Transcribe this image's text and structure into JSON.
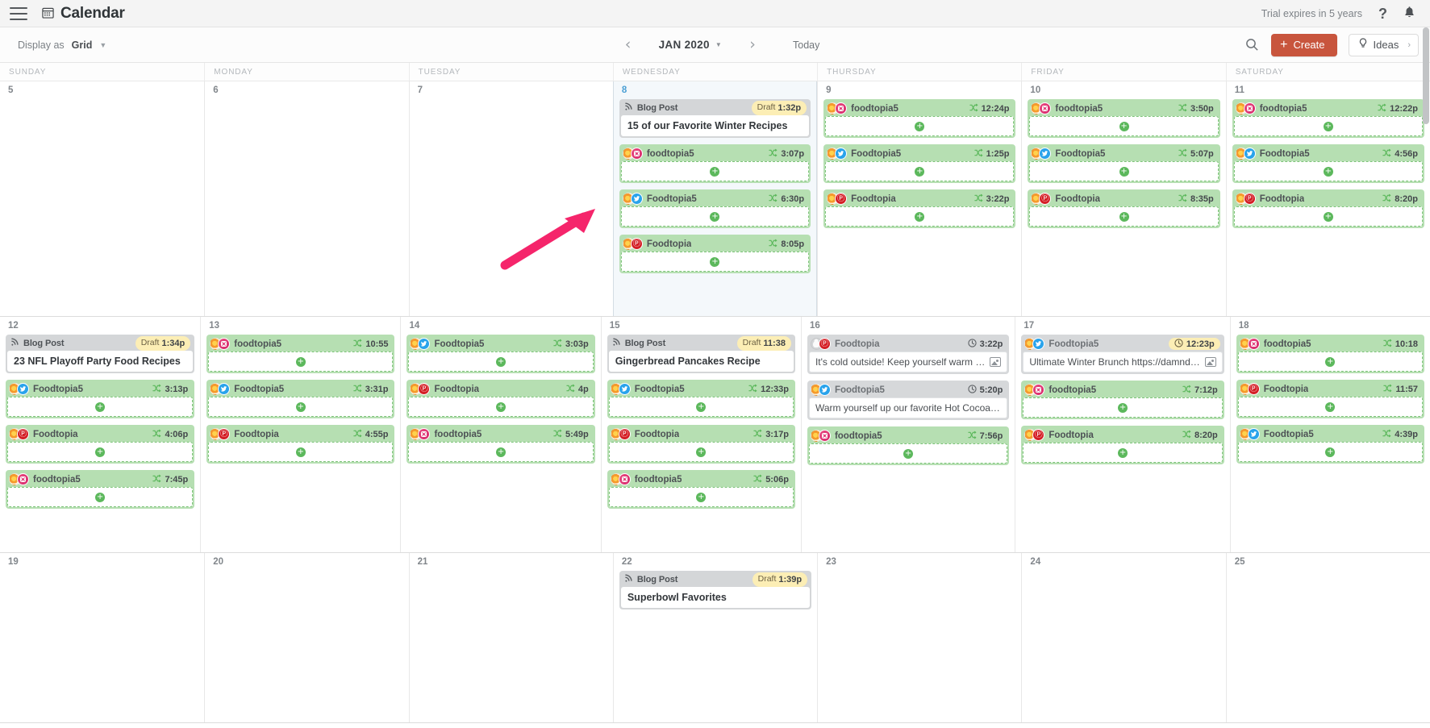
{
  "app": {
    "title": "Calendar",
    "calendar_icon": "calendar-icon",
    "menu_icon": "hamburger-menu-icon",
    "trial_text": "Trial expires in 5 years",
    "help_icon": "?",
    "bell_icon": "⬤"
  },
  "toolbar": {
    "display_as_label": "Display as",
    "display_as_value": "Grid",
    "prev_label": "‹",
    "next_label": "›",
    "month_label": "JAN 2020",
    "today_label": "Today",
    "search_icon": "search-icon",
    "create_label": "Create",
    "ideas_label": "Ideas"
  },
  "colors": {
    "accent": "#c8553d",
    "social_card": "#b6dfb2",
    "blog_card": "#d4d6d8",
    "draft_badge": "#fceeb5",
    "today_bg": "#f4f8fb",
    "today_num": "#4a9fd4",
    "shuffle": "#5cb85c"
  },
  "day_headers": [
    "SUNDAY",
    "MONDAY",
    "TUESDAY",
    "WEDNESDAY",
    "THURSDAY",
    "FRIDAY",
    "SATURDAY"
  ],
  "weeks": [
    [
      {
        "day": "5",
        "today": false,
        "events": []
      },
      {
        "day": "6",
        "today": false,
        "events": []
      },
      {
        "day": "7",
        "today": false,
        "events": []
      },
      {
        "day": "8",
        "today": true,
        "events": [
          {
            "kind": "blog",
            "label": "Blog Post",
            "status": "Draft",
            "time": "1:32p",
            "title": "15 of our Favorite Winter Recipes"
          },
          {
            "kind": "social",
            "network": "ig",
            "name": "foodtopia5",
            "time": "3:07p",
            "time_icon": "shuffle",
            "body": ""
          },
          {
            "kind": "social",
            "network": "tw",
            "name": "Foodtopia5",
            "time": "6:30p",
            "time_icon": "shuffle",
            "body": ""
          },
          {
            "kind": "social",
            "network": "pi",
            "name": "Foodtopia",
            "time": "8:05p",
            "time_icon": "shuffle",
            "body": ""
          }
        ]
      },
      {
        "day": "9",
        "today": false,
        "events": [
          {
            "kind": "social",
            "network": "ig",
            "name": "foodtopia5",
            "time": "12:24p",
            "time_icon": "shuffle",
            "body": ""
          },
          {
            "kind": "social",
            "network": "tw",
            "name": "Foodtopia5",
            "time": "1:25p",
            "time_icon": "shuffle",
            "body": ""
          },
          {
            "kind": "social",
            "network": "pi",
            "name": "Foodtopia",
            "time": "3:22p",
            "time_icon": "shuffle",
            "body": ""
          }
        ]
      },
      {
        "day": "10",
        "today": false,
        "events": [
          {
            "kind": "social",
            "network": "ig",
            "name": "foodtopia5",
            "time": "3:50p",
            "time_icon": "shuffle",
            "body": ""
          },
          {
            "kind": "social",
            "network": "tw",
            "name": "Foodtopia5",
            "time": "5:07p",
            "time_icon": "shuffle",
            "body": ""
          },
          {
            "kind": "social",
            "network": "pi",
            "name": "Foodtopia",
            "time": "8:35p",
            "time_icon": "shuffle",
            "body": ""
          }
        ]
      },
      {
        "day": "11",
        "today": false,
        "events": [
          {
            "kind": "social",
            "network": "ig",
            "name": "foodtopia5",
            "time": "12:22p",
            "time_icon": "shuffle",
            "body": ""
          },
          {
            "kind": "social",
            "network": "tw",
            "name": "Foodtopia5",
            "time": "4:56p",
            "time_icon": "shuffle",
            "body": ""
          },
          {
            "kind": "social",
            "network": "pi",
            "name": "Foodtopia",
            "time": "8:20p",
            "time_icon": "shuffle",
            "body": ""
          }
        ]
      }
    ],
    [
      {
        "day": "12",
        "today": false,
        "events": [
          {
            "kind": "blog",
            "label": "Blog Post",
            "status": "Draft",
            "time": "1:34p",
            "title": "23 NFL Playoff Party Food Recipes"
          },
          {
            "kind": "social",
            "network": "tw",
            "name": "Foodtopia5",
            "time": "3:13p",
            "time_icon": "shuffle",
            "body": ""
          },
          {
            "kind": "social",
            "network": "pi",
            "name": "Foodtopia",
            "time": "4:06p",
            "time_icon": "shuffle",
            "body": ""
          },
          {
            "kind": "social",
            "network": "ig",
            "name": "foodtopia5",
            "time": "7:45p",
            "time_icon": "shuffle",
            "body": ""
          }
        ]
      },
      {
        "day": "13",
        "today": false,
        "events": [
          {
            "kind": "social",
            "network": "ig",
            "name": "foodtopia5",
            "time": "10:55",
            "time_icon": "shuffle",
            "body": ""
          },
          {
            "kind": "social",
            "network": "tw",
            "name": "Foodtopia5",
            "time": "3:31p",
            "time_icon": "shuffle",
            "body": ""
          },
          {
            "kind": "social",
            "network": "pi",
            "name": "Foodtopia",
            "time": "4:55p",
            "time_icon": "shuffle",
            "body": ""
          }
        ]
      },
      {
        "day": "14",
        "today": false,
        "events": [
          {
            "kind": "social",
            "network": "tw",
            "name": "Foodtopia5",
            "time": "3:03p",
            "time_icon": "shuffle",
            "body": ""
          },
          {
            "kind": "social",
            "network": "pi",
            "name": "Foodtopia",
            "time": "4p",
            "time_icon": "shuffle",
            "body": ""
          },
          {
            "kind": "social",
            "network": "ig",
            "name": "foodtopia5",
            "time": "5:49p",
            "time_icon": "shuffle",
            "body": ""
          }
        ]
      },
      {
        "day": "15",
        "today": false,
        "events": [
          {
            "kind": "blog",
            "label": "Blog Post",
            "status": "Draft",
            "time": "11:38",
            "title": "Gingerbread Pancakes Recipe"
          },
          {
            "kind": "social",
            "network": "tw",
            "name": "Foodtopia5",
            "time": "12:33p",
            "time_icon": "shuffle",
            "body": ""
          },
          {
            "kind": "social",
            "network": "pi",
            "name": "Foodtopia",
            "time": "3:17p",
            "time_icon": "shuffle",
            "body": ""
          },
          {
            "kind": "social",
            "network": "ig",
            "name": "foodtopia5",
            "time": "5:06p",
            "time_icon": "shuffle",
            "body": ""
          }
        ]
      },
      {
        "day": "16",
        "today": false,
        "events": [
          {
            "kind": "social",
            "network": "pi",
            "name": "Foodtopia",
            "time": "3:22p",
            "time_icon": "clock",
            "style": "gray",
            "body": "It's cold outside! Keep yourself warm …",
            "has_image": true
          },
          {
            "kind": "social",
            "network": "tw",
            "name": "Foodtopia5",
            "time": "5:20p",
            "time_icon": "clock",
            "style": "gray",
            "body": "Warm yourself up our favorite Hot Cocoa…",
            "has_image": false
          },
          {
            "kind": "social",
            "network": "ig",
            "name": "foodtopia5",
            "time": "7:56p",
            "time_icon": "shuffle",
            "body": ""
          }
        ]
      },
      {
        "day": "17",
        "today": false,
        "events": [
          {
            "kind": "social",
            "network": "tw",
            "name": "Foodtopia5",
            "time": "12:23p",
            "time_icon": "clock",
            "style": "gray",
            "time_style": "amber",
            "body": "Ultimate Winter Brunch https://damnd…",
            "has_image": true
          },
          {
            "kind": "social",
            "network": "ig",
            "name": "foodtopia5",
            "time": "7:12p",
            "time_icon": "shuffle",
            "body": ""
          },
          {
            "kind": "social",
            "network": "pi",
            "name": "Foodtopia",
            "time": "8:20p",
            "time_icon": "shuffle",
            "body": ""
          }
        ]
      },
      {
        "day": "18",
        "today": false,
        "events": [
          {
            "kind": "social",
            "network": "ig",
            "name": "foodtopia5",
            "time": "10:18",
            "time_icon": "shuffle",
            "body": ""
          },
          {
            "kind": "social",
            "network": "pi",
            "name": "Foodtopia",
            "time": "11:57",
            "time_icon": "shuffle",
            "body": ""
          },
          {
            "kind": "social",
            "network": "tw",
            "name": "Foodtopia5",
            "time": "4:39p",
            "time_icon": "shuffle",
            "body": ""
          }
        ]
      }
    ],
    [
      {
        "day": "19",
        "today": false,
        "events": []
      },
      {
        "day": "20",
        "today": false,
        "events": []
      },
      {
        "day": "21",
        "today": false,
        "events": []
      },
      {
        "day": "22",
        "today": false,
        "events": [
          {
            "kind": "blog",
            "label": "Blog Post",
            "status": "Draft",
            "time": "1:39p",
            "title": "Superbowl Favorites"
          }
        ]
      },
      {
        "day": "23",
        "today": false,
        "events": []
      },
      {
        "day": "24",
        "today": false,
        "events": []
      },
      {
        "day": "25",
        "today": false,
        "events": []
      }
    ]
  ]
}
